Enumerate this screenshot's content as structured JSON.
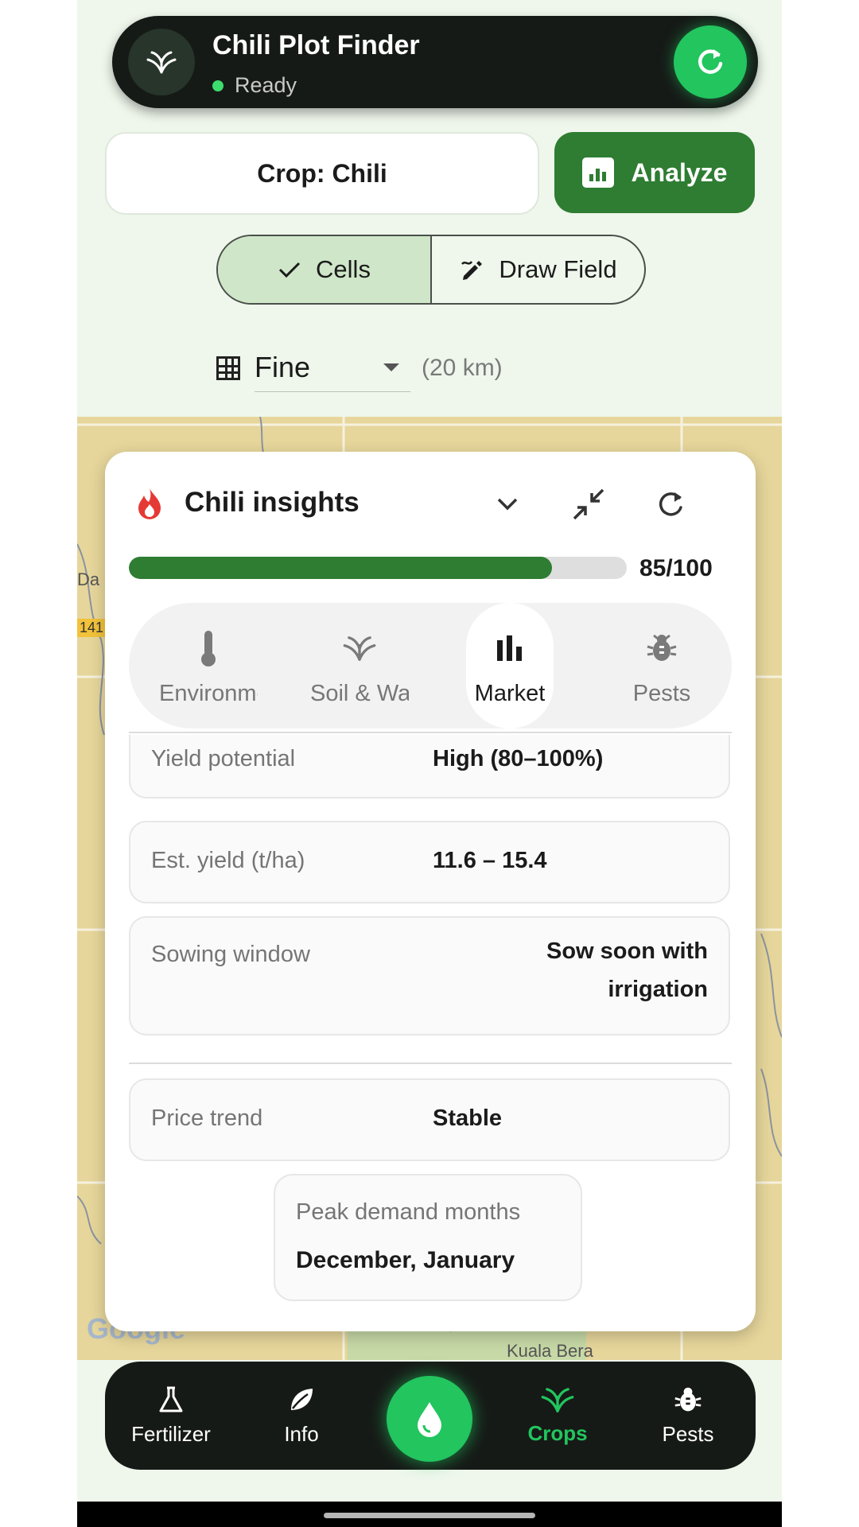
{
  "app": {
    "title": "Chili Plot Finder",
    "status": "Ready",
    "colors": {
      "primary": "#2e7d32",
      "accent": "#22c55e",
      "dark": "#161a17",
      "status_ok": "#3ddc6e"
    }
  },
  "controls": {
    "crop_label": "Crop: Chili",
    "analyze_label": "Analyze",
    "mode_options": [
      {
        "label": "Cells",
        "icon": "check-icon",
        "selected": true
      },
      {
        "label": "Draw Field",
        "icon": "draw-icon",
        "selected": false
      }
    ],
    "resolution": {
      "selected": "Fine",
      "hint": "(20 km)"
    }
  },
  "map": {
    "labels": [
      "Da",
      "141",
      "Kuala Bera"
    ],
    "attribution": "Google"
  },
  "insights": {
    "title": "Chili insights",
    "score": {
      "text": "85/100",
      "value": 85,
      "max": 100
    },
    "tabs": [
      {
        "label": "Environment",
        "icon": "thermometer-icon",
        "active": false
      },
      {
        "label": "Soil & Water",
        "icon": "sprout-icon",
        "active": false
      },
      {
        "label": "Market",
        "icon": "bar-chart-icon",
        "active": true
      },
      {
        "label": "Pests",
        "icon": "bug-icon",
        "active": false
      }
    ],
    "rows": [
      {
        "label": "Yield potential",
        "value": "High (80–100%)"
      },
      {
        "label": "Est. yield (t/ha)",
        "value": "11.6 – 15.4"
      },
      {
        "label": "Sowing window",
        "value": "Sow soon with irrigation"
      },
      {
        "label": "Price trend",
        "value": "Stable"
      }
    ],
    "peak": {
      "label": "Peak demand months",
      "value": "December, January"
    }
  },
  "nav": {
    "items": [
      {
        "label": "Fertilizer",
        "icon": "flask-icon",
        "active": false
      },
      {
        "label": "Info",
        "icon": "leaf-icon",
        "active": false
      },
      {
        "label": "Crops",
        "icon": "sprout-icon",
        "active": true
      },
      {
        "label": "Pests",
        "icon": "bug-icon",
        "active": false
      }
    ],
    "center_icon": "water-drop-icon"
  }
}
